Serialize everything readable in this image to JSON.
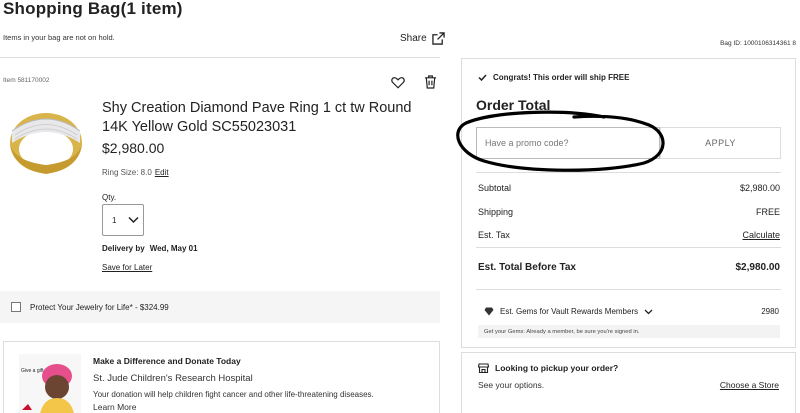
{
  "header": {
    "title": "Shopping Bag",
    "count": "(1 item)",
    "hold_note": "Items in your bag are not on hold.",
    "share_label": "Share",
    "bag_id": "Bag ID: 1000106314361 8"
  },
  "item": {
    "item_no": "Item 581170002",
    "name": "Shy Creation Diamond Pave Ring 1 ct tw Round 14K Yellow Gold SC55023031",
    "price": "$2,980.00",
    "ring_size_label": "Ring Size: 8.0",
    "edit_label": "Edit",
    "qty_label": "Qty.",
    "qty_value": "1",
    "delivery_label": "Delivery by",
    "delivery_date": "Wed, May 01",
    "save_later": "Save for Later"
  },
  "protect": {
    "label": "Protect Your Jewelry for Life* - $324.99"
  },
  "donate": {
    "title": "Make a Difference and Donate Today",
    "org": "St. Jude Children's Research Hospital",
    "desc": "Your donation will help children fight cancer and other life-threatening diseases.",
    "more": "Learn More",
    "img_text": "Give a gift"
  },
  "summary": {
    "ship_free": "Congrats! This order will ship FREE",
    "order_total": "Order Total",
    "promo_placeholder": "Have a promo code?",
    "apply": "APPLY",
    "subtotal_label": "Subtotal",
    "subtotal_value": "$2,980.00",
    "shipping_label": "Shipping",
    "shipping_value": "FREE",
    "tax_label": "Est. Tax",
    "tax_value": "Calculate",
    "total_label": "Est. Total Before Tax",
    "total_value": "$2,980.00",
    "gems_label": "Est. Gems for Vault Rewards Members",
    "gems_value": "2980",
    "gems_note": "Get your Gems: Already a member, be sure you're signed in."
  },
  "pickup": {
    "title": "Looking to pickup your order?",
    "options": "See your options.",
    "choose": "Choose a Store"
  },
  "colors": {
    "annotation": "#000000",
    "gold": "#d9b44a"
  }
}
